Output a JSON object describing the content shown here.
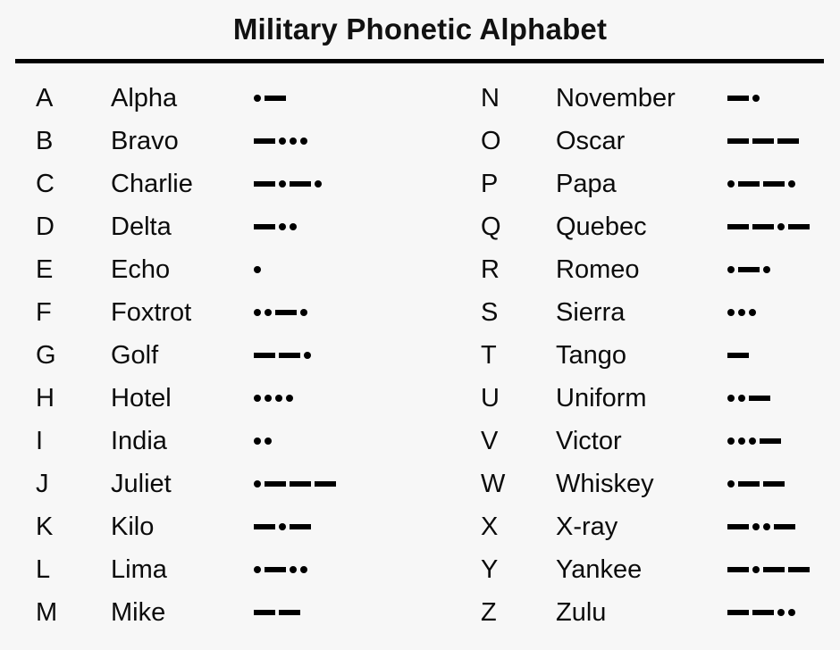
{
  "page": {
    "title": "Military Phonetic Alphabet",
    "background_color": "#f7f7f7",
    "text_color": "#000000",
    "rule_color": "#000000"
  },
  "table": {
    "left_column": [
      {
        "letter": "A",
        "word": "Alpha",
        "code": ".-"
      },
      {
        "letter": "B",
        "word": "Bravo",
        "code": "-..."
      },
      {
        "letter": "C",
        "word": "Charlie",
        "code": "-.-."
      },
      {
        "letter": "D",
        "word": "Delta",
        "code": "-.."
      },
      {
        "letter": "E",
        "word": "Echo",
        "code": "."
      },
      {
        "letter": "F",
        "word": "Foxtrot",
        "code": "..-."
      },
      {
        "letter": "G",
        "word": "Golf",
        "code": "--."
      },
      {
        "letter": "H",
        "word": "Hotel",
        "code": "...."
      },
      {
        "letter": "I",
        "word": "India",
        "code": ".."
      },
      {
        "letter": "J",
        "word": "Juliet",
        "code": ".---"
      },
      {
        "letter": "K",
        "word": "Kilo",
        "code": "-.-"
      },
      {
        "letter": "L",
        "word": "Lima",
        "code": ".-.."
      },
      {
        "letter": "M",
        "word": "Mike",
        "code": "--"
      }
    ],
    "right_column": [
      {
        "letter": "N",
        "word": "November",
        "code": "-."
      },
      {
        "letter": "O",
        "word": "Oscar",
        "code": "---"
      },
      {
        "letter": "P",
        "word": "Papa",
        "code": ".--."
      },
      {
        "letter": "Q",
        "word": "Quebec",
        "code": "--.-"
      },
      {
        "letter": "R",
        "word": "Romeo",
        "code": ".-."
      },
      {
        "letter": "S",
        "word": "Sierra",
        "code": "..."
      },
      {
        "letter": "T",
        "word": "Tango",
        "code": "-"
      },
      {
        "letter": "U",
        "word": "Uniform",
        "code": "..-"
      },
      {
        "letter": "V",
        "word": "Victor",
        "code": "...-"
      },
      {
        "letter": "W",
        "word": "Whiskey",
        "code": ".--"
      },
      {
        "letter": "X",
        "word": "X-ray",
        "code": "-..-"
      },
      {
        "letter": "Y",
        "word": "Yankee",
        "code": "-.--"
      },
      {
        "letter": "Z",
        "word": "Zulu",
        "code": "--.."
      }
    ]
  }
}
